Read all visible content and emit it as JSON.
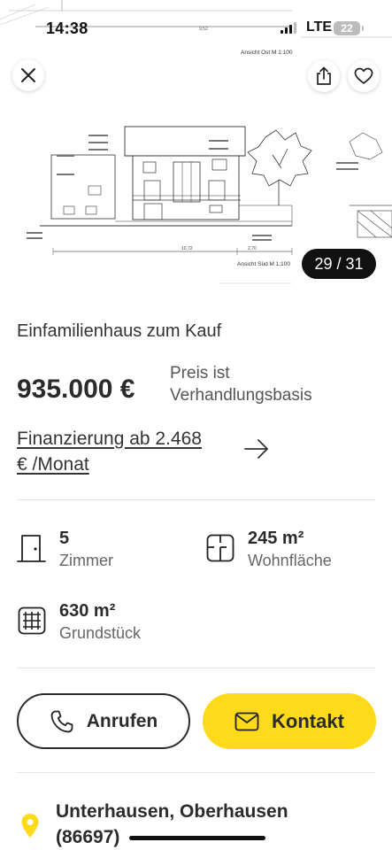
{
  "status_bar": {
    "time": "14:38",
    "network": "LTE",
    "battery": "22"
  },
  "hero": {
    "image_counter": "29 / 31",
    "plan_labels": {
      "view_east": "Ansicht Ost M 1:100",
      "view_south": "Ansicht Süd M 1:100",
      "dim_1": "10,72",
      "dim_2": "2,70",
      "dim_top": "9,52"
    }
  },
  "listing": {
    "title": "Einfamilienhaus zum Kauf",
    "price": "935.000 €",
    "price_note_line1": "Preis ist",
    "price_note_line2": "Verhandlungsbasis",
    "financing_line1": "Finanzierung ab 2.468",
    "financing_line2": "€ /Monat"
  },
  "features": [
    {
      "value": "5",
      "label": "Zimmer",
      "icon": "door-icon"
    },
    {
      "value": "245 m²",
      "label": "Wohnfläche",
      "icon": "floorplan-icon"
    },
    {
      "value": "630 m²",
      "label": "Grundstück",
      "icon": "grid-plot-icon"
    }
  ],
  "actions": {
    "call_label": "Anrufen",
    "contact_label": "Kontakt"
  },
  "location": {
    "line1": "Unterhausen, Oberhausen",
    "line2": "(86697)"
  },
  "colors": {
    "accent": "#ffda1a",
    "text": "#2b2b2b"
  }
}
